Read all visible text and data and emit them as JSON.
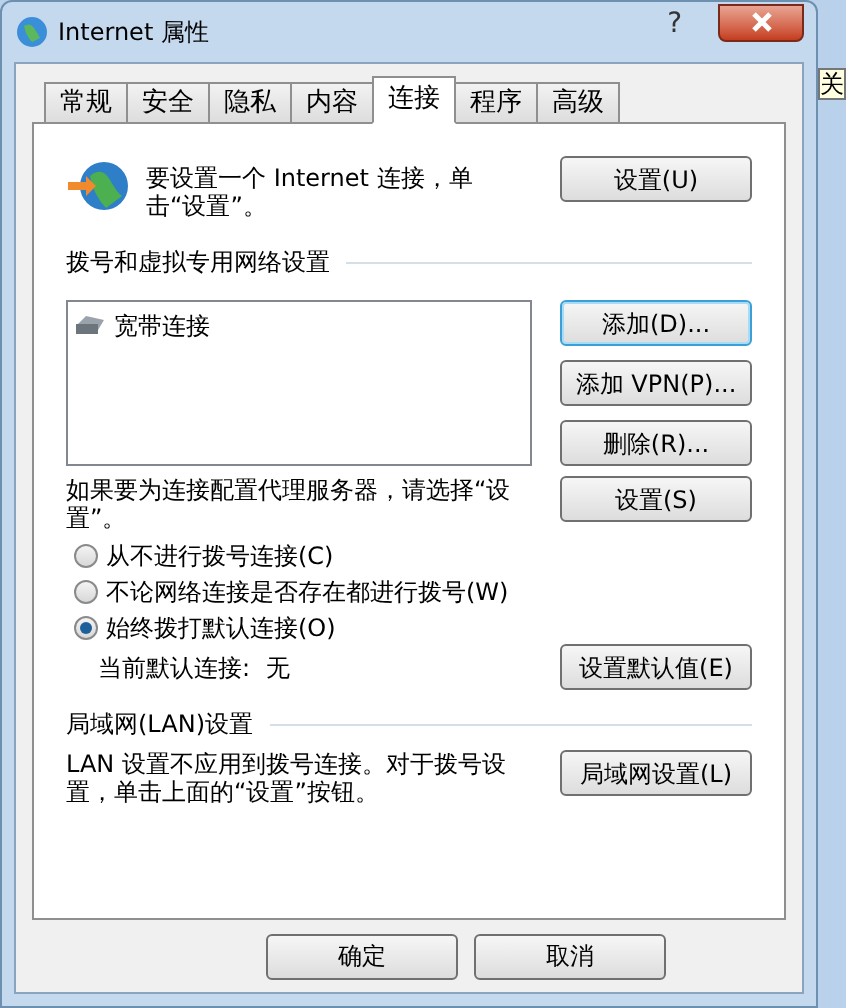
{
  "window": {
    "title": "Internet 属性",
    "help": "?"
  },
  "background_text": "关",
  "tabs": [
    {
      "label": "常规",
      "selected": false
    },
    {
      "label": "安全",
      "selected": false
    },
    {
      "label": "隐私",
      "selected": false
    },
    {
      "label": "内容",
      "selected": false
    },
    {
      "label": "连接",
      "selected": true
    },
    {
      "label": "程序",
      "selected": false
    },
    {
      "label": "高级",
      "selected": false
    }
  ],
  "setup": {
    "text": "要设置一个 Internet 连接，单击“设置”。",
    "button": "设置(U)"
  },
  "dialup": {
    "heading": "拨号和虚拟专用网络设置",
    "connections": [
      {
        "name": "宽带连接"
      }
    ],
    "buttons": [
      {
        "label": "添加(D)...",
        "focused": true
      },
      {
        "label": "添加 VPN(P)...",
        "focused": false
      },
      {
        "label": "删除(R)...",
        "focused": false
      }
    ],
    "proxy_text": "如果要为连接配置代理服务器，请选择“设置”。",
    "proxy_button": "设置(S)",
    "options": [
      {
        "label": "从不进行拨号连接(C)",
        "selected": false
      },
      {
        "label": "不论网络连接是否存在都进行拨号(W)",
        "selected": false
      },
      {
        "label": "始终拨打默认连接(O)",
        "selected": true
      }
    ],
    "default_label": "当前默认连接:",
    "default_value": "无",
    "default_button": "设置默认值(E)"
  },
  "lan": {
    "heading": "局域网(LAN)设置",
    "text": "LAN 设置不应用到拨号连接。对于拨号设置，单击上面的“设置”按钮。",
    "button": "局域网设置(L)"
  },
  "footer_buttons": [
    "确定",
    "取消"
  ]
}
